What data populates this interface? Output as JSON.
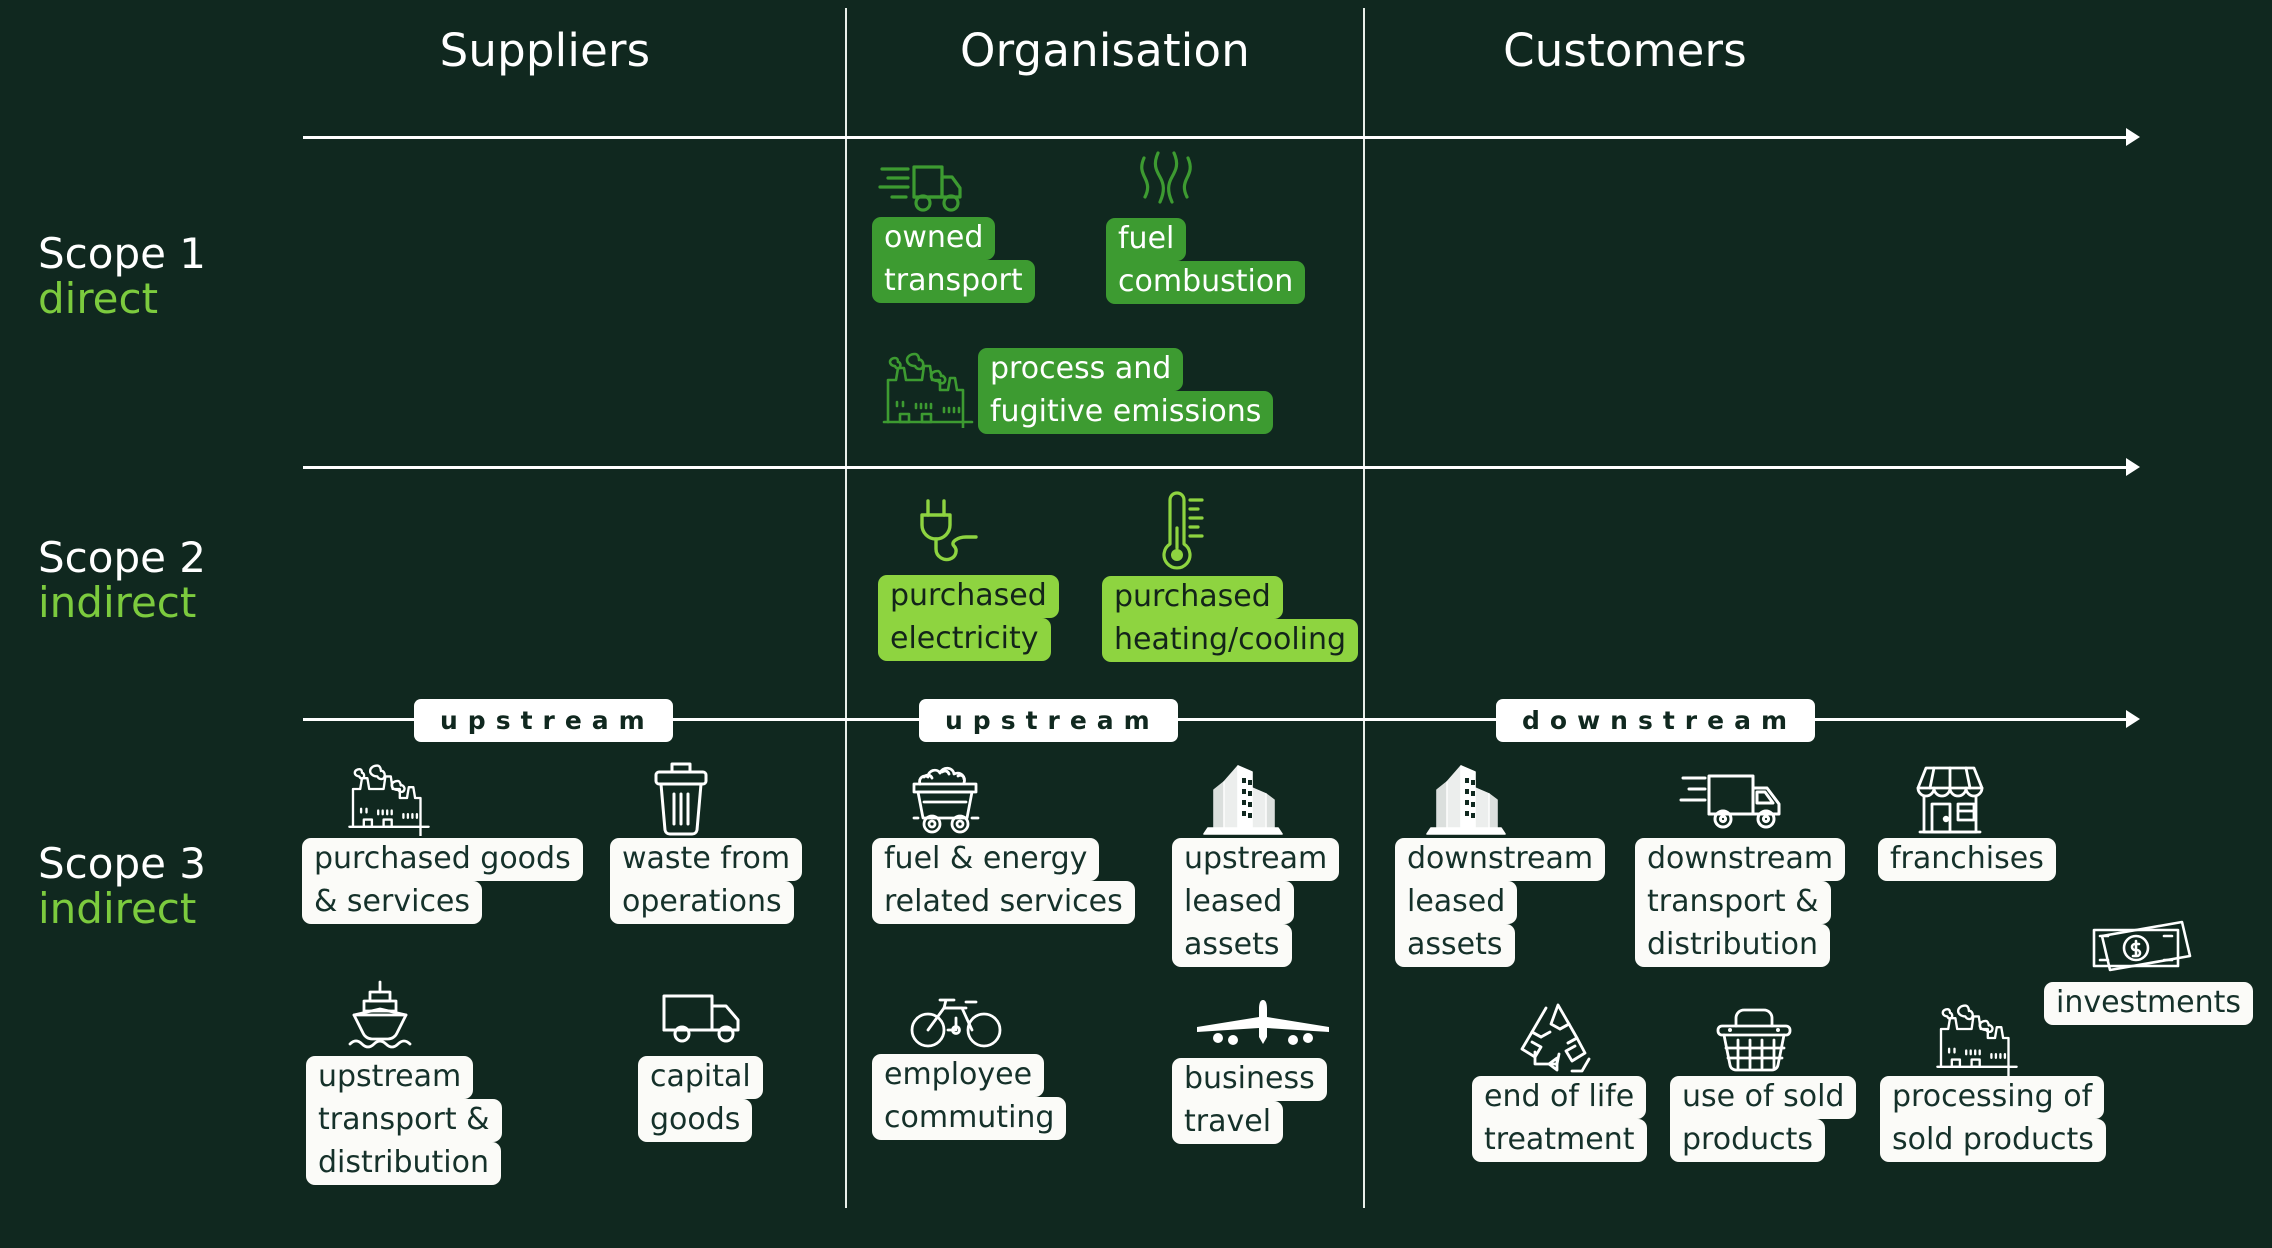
{
  "palette": {
    "background": "#10281f",
    "scope1_box": "#3d9b31",
    "scope2_box": "#8ed440",
    "scope3_box": "#fbfbf8",
    "accent_green": "#7ccb3e",
    "line_white": "#ffffff"
  },
  "columns": [
    {
      "label": "Suppliers"
    },
    {
      "label": "Organisation"
    },
    {
      "label": "Customers"
    }
  ],
  "scopes": [
    {
      "title": "Scope 1",
      "subtitle": "direct"
    },
    {
      "title": "Scope 2",
      "subtitle": "indirect"
    },
    {
      "title": "Scope 3",
      "subtitle": "indirect"
    }
  ],
  "stream_labels": [
    {
      "text": "upstream",
      "column": "Suppliers"
    },
    {
      "text": "upstream",
      "column": "Organisation"
    },
    {
      "text": "downstream",
      "column": "Customers"
    }
  ],
  "items": {
    "scope1": [
      {
        "icon": "delivery-truck-icon",
        "lines": [
          "owned",
          "transport"
        ]
      },
      {
        "icon": "smoke-fumes-icon",
        "lines": [
          "fuel",
          "combustion"
        ]
      },
      {
        "icon": "factory-icon",
        "lines": [
          "process and",
          "fugitive emissions"
        ]
      }
    ],
    "scope2": [
      {
        "icon": "power-plug-icon",
        "lines": [
          "purchased",
          "electricity"
        ]
      },
      {
        "icon": "thermometer-icon",
        "lines": [
          "purchased",
          "heating/cooling"
        ]
      }
    ],
    "scope3_suppliers": [
      {
        "icon": "factory-icon",
        "lines": [
          "purchased goods",
          "& services"
        ]
      },
      {
        "icon": "trash-bin-icon",
        "lines": [
          "waste from",
          "operations"
        ]
      },
      {
        "icon": "cargo-ship-icon",
        "lines": [
          "upstream",
          "transport &",
          "distribution"
        ]
      },
      {
        "icon": "box-truck-icon",
        "lines": [
          "capital",
          "goods"
        ]
      }
    ],
    "scope3_organisation": [
      {
        "icon": "coal-cart-icon",
        "lines": [
          "fuel & energy",
          "related services"
        ]
      },
      {
        "icon": "buildings-icon",
        "lines": [
          "upstream",
          "leased",
          "assets"
        ]
      },
      {
        "icon": "bicycle-icon",
        "lines": [
          "employee",
          "commuting"
        ]
      },
      {
        "icon": "airplane-icon",
        "lines": [
          "business",
          "travel"
        ]
      }
    ],
    "scope3_customers": [
      {
        "icon": "buildings-icon",
        "lines": [
          "downstream",
          "leased",
          "assets"
        ]
      },
      {
        "icon": "delivery-truck-icon",
        "lines": [
          "downstream",
          "transport &",
          "distribution"
        ]
      },
      {
        "icon": "storefront-icon",
        "lines": [
          "franchises"
        ]
      },
      {
        "icon": "banknotes-icon",
        "lines": [
          "investments"
        ]
      },
      {
        "icon": "recycle-icon",
        "lines": [
          "end of life",
          "treatment"
        ]
      },
      {
        "icon": "shopping-basket-icon",
        "lines": [
          "use of sold",
          "products"
        ]
      },
      {
        "icon": "factory-icon",
        "lines": [
          "processing of",
          "sold products"
        ]
      }
    ]
  }
}
